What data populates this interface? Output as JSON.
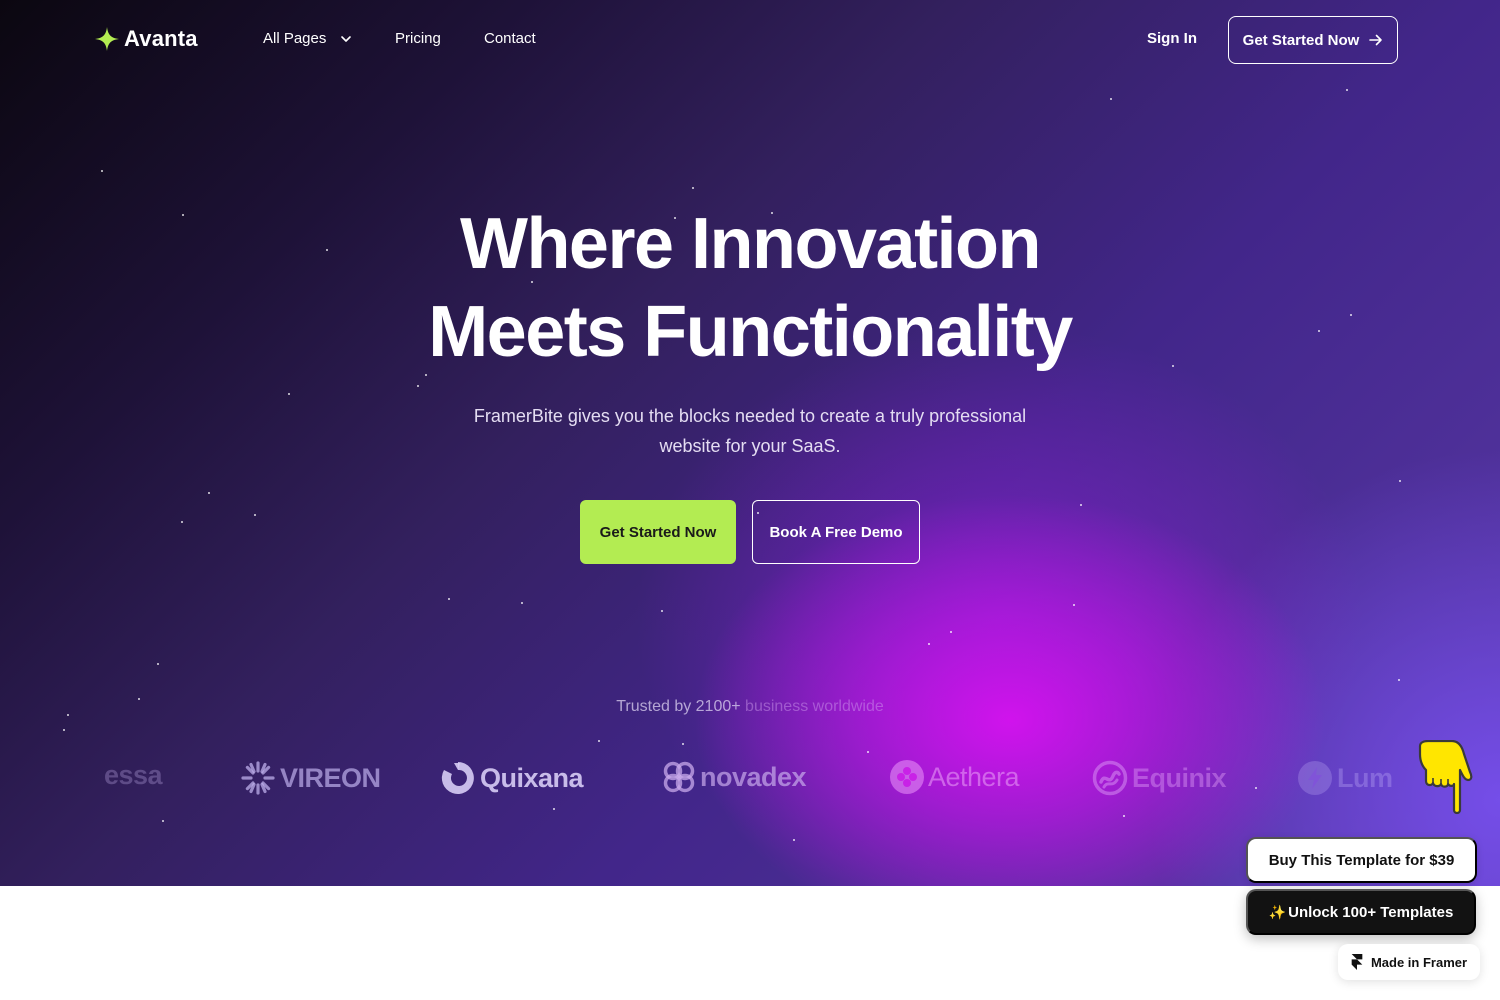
{
  "nav": {
    "brand": "Avanta",
    "links": [
      {
        "label": "All Pages",
        "has_dropdown": true
      },
      {
        "label": "Pricing"
      },
      {
        "label": "Contact"
      }
    ],
    "sign_in": "Sign In",
    "cta": "Get Started Now"
  },
  "hero": {
    "headline_line1": "Where Innovation",
    "headline_line2": "Meets Functionality",
    "subtitle": "FramerBite gives you the blocks needed to create a truly professional website for your SaaS.",
    "primary_button": "Get Started Now",
    "secondary_button": "Book A Free Demo",
    "trusted_prefix": "Trusted by 2100+",
    "trusted_suffix": " business worldwide"
  },
  "logos": [
    {
      "name": "essa",
      "icon": "partial-logo"
    },
    {
      "name": "VIREON",
      "icon": "sunburst-icon"
    },
    {
      "name": "Quixana",
      "icon": "ring-icon"
    },
    {
      "name": "novadex",
      "icon": "interlock-icon"
    },
    {
      "name": "Aethera",
      "icon": "clover-icon"
    },
    {
      "name": "Equinix",
      "icon": "wave-circle-icon"
    },
    {
      "name": "Lum",
      "icon": "bolt-icon"
    }
  ],
  "framer": {
    "buy_label": "Buy This Template for $39",
    "unlock_label": "Unlock 100+ Templates",
    "made_in": "Made in Framer"
  },
  "colors": {
    "accent_green": "#b3ec52",
    "hero_magenta": "#d612f0",
    "hero_purple": "#42268a",
    "dark_button": "#121212"
  }
}
